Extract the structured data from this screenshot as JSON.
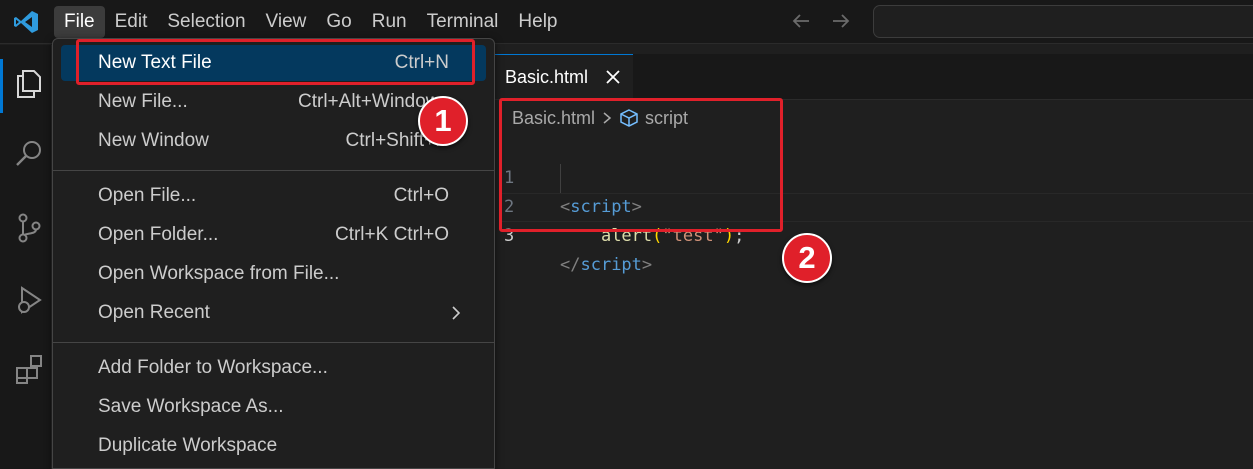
{
  "menubar": {
    "items": [
      "File",
      "Edit",
      "Selection",
      "View",
      "Go",
      "Run",
      "Terminal",
      "Help"
    ],
    "active": "File"
  },
  "file_menu": {
    "groups": [
      [
        {
          "label": "New Text File",
          "shortcut": "Ctrl+N"
        },
        {
          "label": "New File...",
          "shortcut": "Ctrl+Alt+Windows"
        },
        {
          "label": "New Window",
          "shortcut": "Ctrl+Shift+N"
        }
      ],
      [
        {
          "label": "Open File...",
          "shortcut": "Ctrl+O"
        },
        {
          "label": "Open Folder...",
          "shortcut": "Ctrl+K Ctrl+O"
        },
        {
          "label": "Open Workspace from File...",
          "shortcut": ""
        },
        {
          "label": "Open Recent",
          "shortcut": ""
        }
      ],
      [
        {
          "label": "Add Folder to Workspace...",
          "shortcut": ""
        },
        {
          "label": "Save Workspace As...",
          "shortcut": ""
        },
        {
          "label": "Duplicate Workspace",
          "shortcut": ""
        }
      ]
    ]
  },
  "editor": {
    "tab": {
      "label": "Basic.html"
    },
    "breadcrumb": {
      "file": "Basic.html",
      "symbol": "script"
    },
    "line_numbers": [
      "1",
      "2",
      "3"
    ],
    "code": {
      "open_tag": "script",
      "fn": "alert",
      "arg": "\"test\"",
      "close_tag": "script"
    }
  },
  "annotations": {
    "badge1": "1",
    "badge2": "2",
    "color": "#e0202a"
  },
  "colors": {
    "accent": "#0078d4",
    "menu_highlight": "#04395e"
  }
}
